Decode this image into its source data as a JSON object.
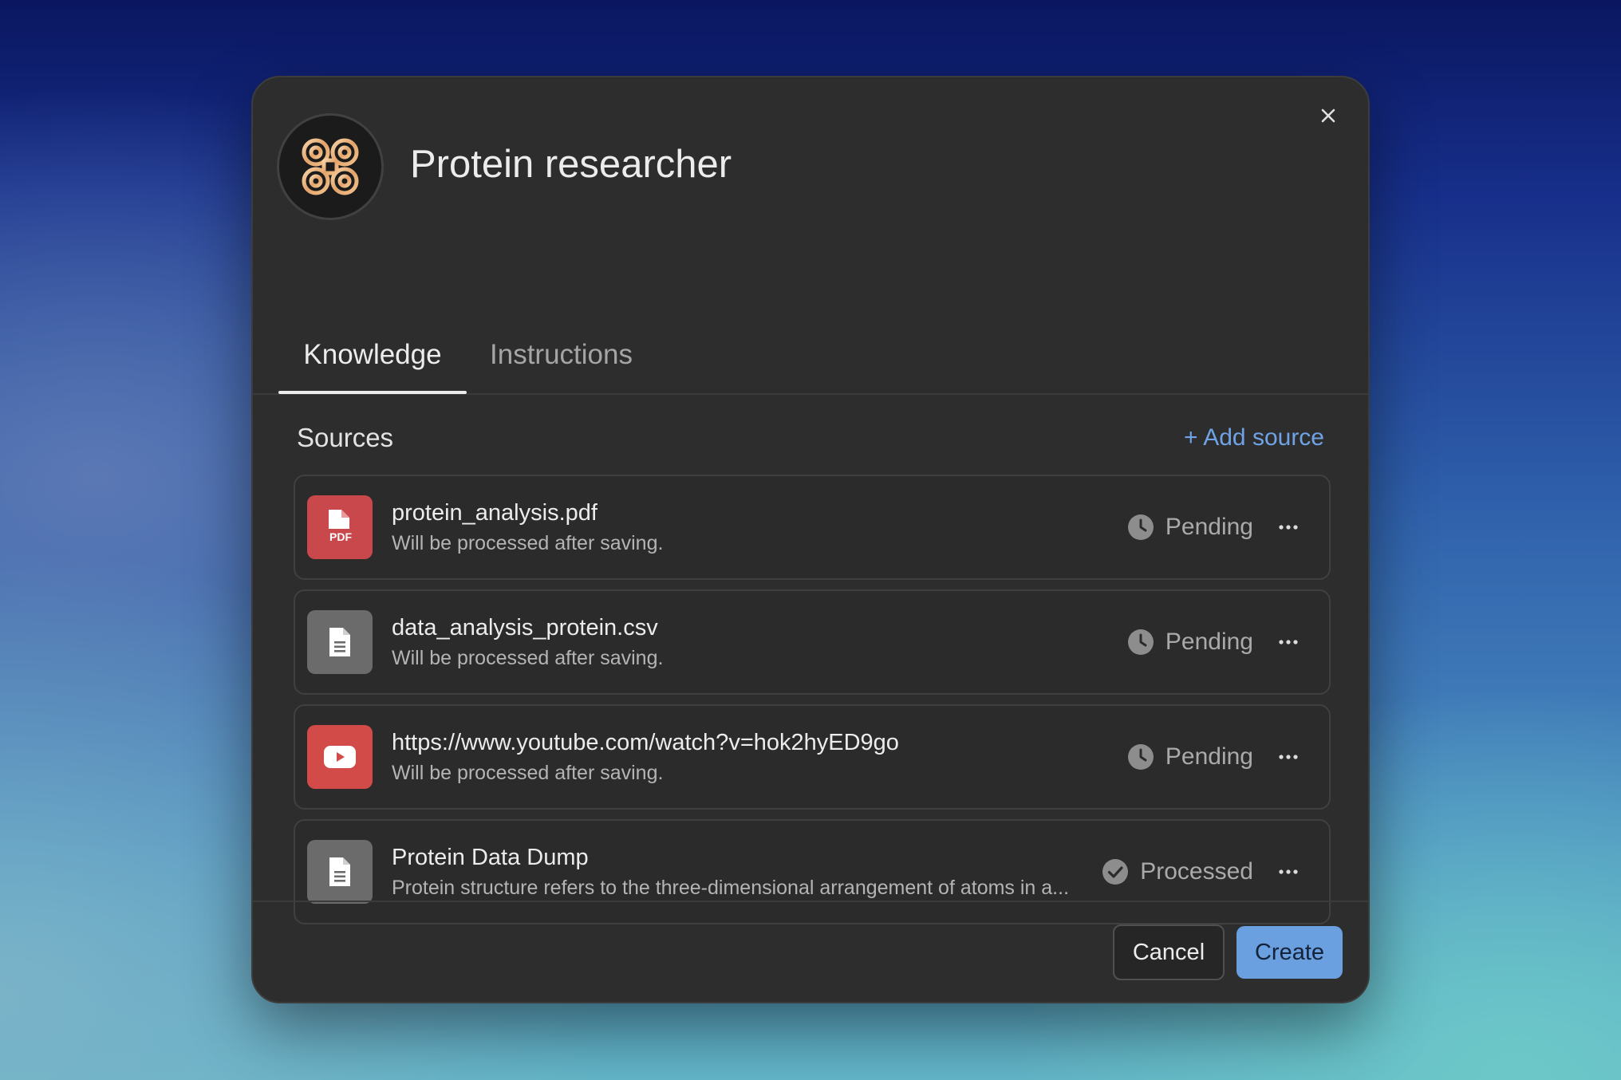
{
  "dialog": {
    "title": "Protein researcher",
    "avatar_icon": "looped-square-icon",
    "close_icon": "close-icon"
  },
  "tabs": [
    {
      "label": "Knowledge",
      "active": true
    },
    {
      "label": "Instructions",
      "active": false
    }
  ],
  "sources": {
    "heading": "Sources",
    "add_label": "+ Add source",
    "items": [
      {
        "title": "protein_analysis.pdf",
        "subtitle": "Will be processed after saving.",
        "type_icon": "pdf-file-icon",
        "icon_color": "#c9484b",
        "status": "Pending",
        "status_icon": "clock-icon"
      },
      {
        "title": "data_analysis_protein.csv",
        "subtitle": "Will be processed after saving.",
        "type_icon": "document-icon",
        "icon_color": "#6b6b6b",
        "status": "Pending",
        "status_icon": "clock-icon"
      },
      {
        "title": "https://www.youtube.com/watch?v=hok2hyED9go",
        "subtitle": "Will be processed after saving.",
        "type_icon": "youtube-icon",
        "icon_color": "#d24b48",
        "status": "Pending",
        "status_icon": "clock-icon"
      },
      {
        "title": "Protein Data Dump",
        "subtitle": "Protein structure refers to the three-dimensional arrangement of atoms in a...",
        "type_icon": "document-icon",
        "icon_color": "#6b6b6b",
        "status": "Processed",
        "status_icon": "check-circle-icon"
      }
    ]
  },
  "footer": {
    "cancel_label": "Cancel",
    "create_label": "Create"
  },
  "colors": {
    "accent": "#6a9fe0",
    "link": "#6fa3e6",
    "dialog_background": "#2d2d2d"
  }
}
